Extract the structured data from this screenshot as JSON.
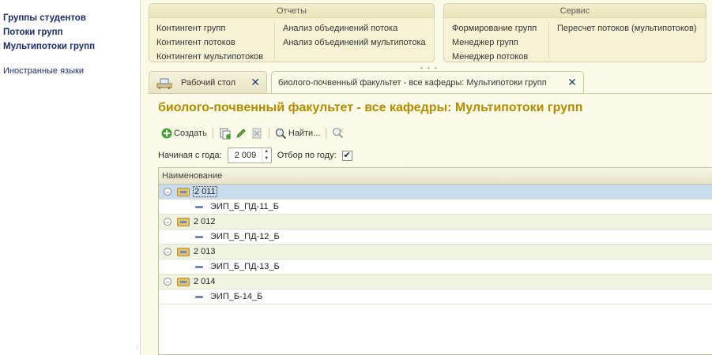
{
  "sidebar": {
    "items": [
      {
        "label": "Группы студентов"
      },
      {
        "label": "Потоки групп"
      },
      {
        "label": "Мультипотоки групп"
      }
    ],
    "extra": {
      "label": "Иностранные языки"
    }
  },
  "reports_panel": {
    "title": "Отчеты",
    "col1": [
      "Контингент групп",
      "Контингент потоков",
      "Контингент мультипотоков"
    ],
    "col2": [
      "Анализ объединений потока",
      "Анализ объединений мультипотока"
    ]
  },
  "service_panel": {
    "title": "Сервис",
    "col1": [
      "Формирование групп",
      "Менеджер групп",
      "Менеджер потоков"
    ],
    "col2": [
      "Пересчет потоков (мультипотоков)"
    ]
  },
  "tabs": [
    {
      "label": "Рабочий стол",
      "icon": "desk-icon"
    },
    {
      "label": "биолого-почвенный факультет - все кафедры: Мультипотоки групп"
    }
  ],
  "main": {
    "title": "биолого-почвенный факультет - все кафедры: Мультипотоки групп",
    "toolbar": {
      "create": "Создать",
      "find": "Найти..."
    },
    "filter": {
      "start_year_label": "Начиная с года:",
      "start_year_value": "2 009",
      "by_year_label": "Отбор по году:",
      "by_year_checked": true
    },
    "table": {
      "column": "Наименование",
      "rows": [
        {
          "type": "group",
          "text": "2 011",
          "selected": true
        },
        {
          "type": "child",
          "text": "ЭИП_Б_ПД-11_Б"
        },
        {
          "type": "group",
          "text": "2 012"
        },
        {
          "type": "child",
          "text": "ЭИП_Б_ПД-12_Б"
        },
        {
          "type": "group",
          "text": "2 013"
        },
        {
          "type": "child",
          "text": "ЭИП_Б_ПД-13_Б"
        },
        {
          "type": "group",
          "text": "2 014"
        },
        {
          "type": "child",
          "text": "ЭИП_Б-14_Б"
        }
      ]
    }
  },
  "colors": {
    "title": "#b38a00",
    "nav": "#1a2d6b",
    "selected_row": "#c7dcef",
    "group_row": "#eef3e2"
  }
}
